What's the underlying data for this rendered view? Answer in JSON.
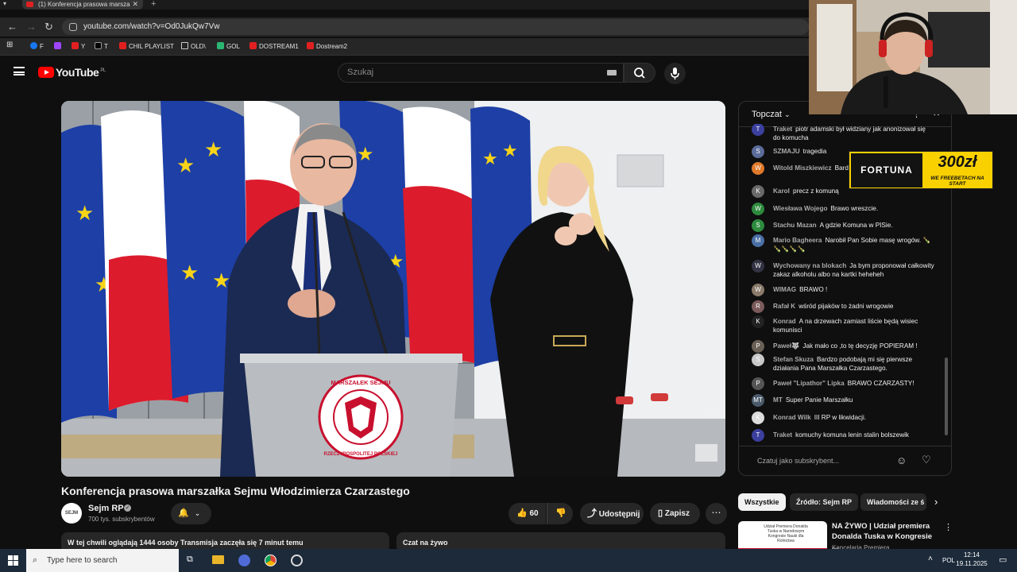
{
  "browser": {
    "tab_title": "(1) Konferencja prasowa marsza",
    "url": "youtube.com/watch?v=Od0JukQw7Vw",
    "bookmarks": [
      {
        "label": "F",
        "color": "#1877f2"
      },
      {
        "label": "",
        "color": "#a044ff"
      },
      {
        "label": "Y",
        "color": "#e02020"
      },
      {
        "label": "T",
        "color": "#222222"
      },
      {
        "label": "CHIL PLAYLIST",
        "color": "#e02020"
      },
      {
        "label": "OLD\\",
        "color": "#888888"
      },
      {
        "label": "GOL",
        "color": "#2bb673"
      },
      {
        "label": "DOSTREAM1",
        "color": "#e02020"
      },
      {
        "label": "Dostream2",
        "color": "#e02020"
      }
    ]
  },
  "youtube": {
    "logo_text": "YouTube",
    "region": "PL",
    "search_placeholder": "Szukaj"
  },
  "video": {
    "title": "Konferencja prasowa marszałka Sejmu Włodzimierza Czarzastego",
    "channel": "Sejm RP",
    "channel_avatar_text": "SEJM",
    "subscribers": "700 tys. subskrybentów",
    "likes": "60",
    "share_label": "Udostępnij",
    "save_label": "Zapisz",
    "podium_seal_top": "MARSZAŁEK SEJMU",
    "podium_seal_bottom": "RZECZYPOSPOLITEJ POLSKIEJ",
    "description_line": "W tej chwili oglądają 1444 osoby  Transmisja zaczęła się 7 minut temu",
    "chat_collapsed_label": "Czat na żywo"
  },
  "chat": {
    "mode": "Topczat",
    "input_placeholder": "Czatuj jako subskrybent...",
    "messages": [
      {
        "author": "Traket",
        "text": "piotr adamski był widziany jak anonizował się do komucha",
        "color": "#3b3f9e",
        "initial": "T"
      },
      {
        "author": "SZMAJU",
        "text": "tragedia",
        "color": "#5b6c9a",
        "initial": "S"
      },
      {
        "author": "Witold Miszkiewicz",
        "text": "Bardzo dobrze Panie Marszałka!",
        "color": "#e07a2a",
        "initial": "W"
      },
      {
        "author": "Karol",
        "text": "precz z komuną",
        "color": "#6a6a6a",
        "initial": "K"
      },
      {
        "author": "Wiesława Wojego",
        "text": "Brawo wreszcie.",
        "color": "#2e8b3e",
        "initial": "W"
      },
      {
        "author": "Stachu Mazan",
        "text": "A gdzie Komuna w PISie.",
        "color": "#2e8b3e",
        "initial": "S"
      },
      {
        "author": "Mario Bagheera",
        "text": "Narobił Pan Sobie masę wrogów. 🍾🍾🍾🍾🍾",
        "color": "#4a6fa5",
        "initial": "M"
      },
      {
        "author": "Wychowany na blokach",
        "text": "Ja bym proponował całkowity zakaz alkoholu albo na kartki heheheh",
        "color": "#333344",
        "initial": "W"
      },
      {
        "author": "WIMAG",
        "text": "BRAWO !",
        "color": "#8a7a6a",
        "initial": "W"
      },
      {
        "author": "Rafał K",
        "text": "wśród pijaków to żadni wrogowie",
        "color": "#7a5a5a",
        "initial": "R"
      },
      {
        "author": "Konrad",
        "text": "A na drzewach zamiast liście będą wisiec komunisci",
        "color": "#222222",
        "initial": "K"
      },
      {
        "author": "Paweł🐺",
        "text": "Jak mało co ,to tę decyzję POPIERAM !",
        "color": "#6a6055",
        "initial": "P"
      },
      {
        "author": "Stefan Skuza",
        "text": "Bardzo podobają mi się pierwsze działania Pana Marszałka Czarzastego.",
        "color": "#c8c8c8",
        "initial": "S"
      },
      {
        "author": "Paweł \"Lipathor\" Lipka",
        "text": "BRAWO CZARZASTY!",
        "color": "#555555",
        "initial": "P"
      },
      {
        "author": "MT",
        "text": "Super Panie Marszałku",
        "color": "#4a5a6a",
        "initial": "MT"
      },
      {
        "author": "Konrad Wilk",
        "text": "III RP w likwidacji.",
        "color": "#dddddd",
        "initial": "K"
      },
      {
        "author": "Traket",
        "text": "komuchy komuna lenin stalin bolszewik",
        "color": "#3b3f9e",
        "initial": "T"
      }
    ]
  },
  "ad": {
    "brand": "FORTUNA",
    "amount": "300zł",
    "tagline": "WE FREEBETACH NA START"
  },
  "chips": [
    "Wszystkie",
    "Źródło: Sejm RP",
    "Wiadomości ze ś"
  ],
  "recommendation": {
    "title": "NA ŻYWO | Udział premiera Donalda Tuska w Kongresie ...",
    "channel": "Kancelaria Premiera",
    "thumb_text": "Udział Premiera Donalda Tuska w Narodowym Kongresie Nauki dla Rolnictwa"
  },
  "taskbar": {
    "search_placeholder": "Type here to search",
    "language": "POL",
    "time": "12:14",
    "date": "19.11.2025"
  }
}
